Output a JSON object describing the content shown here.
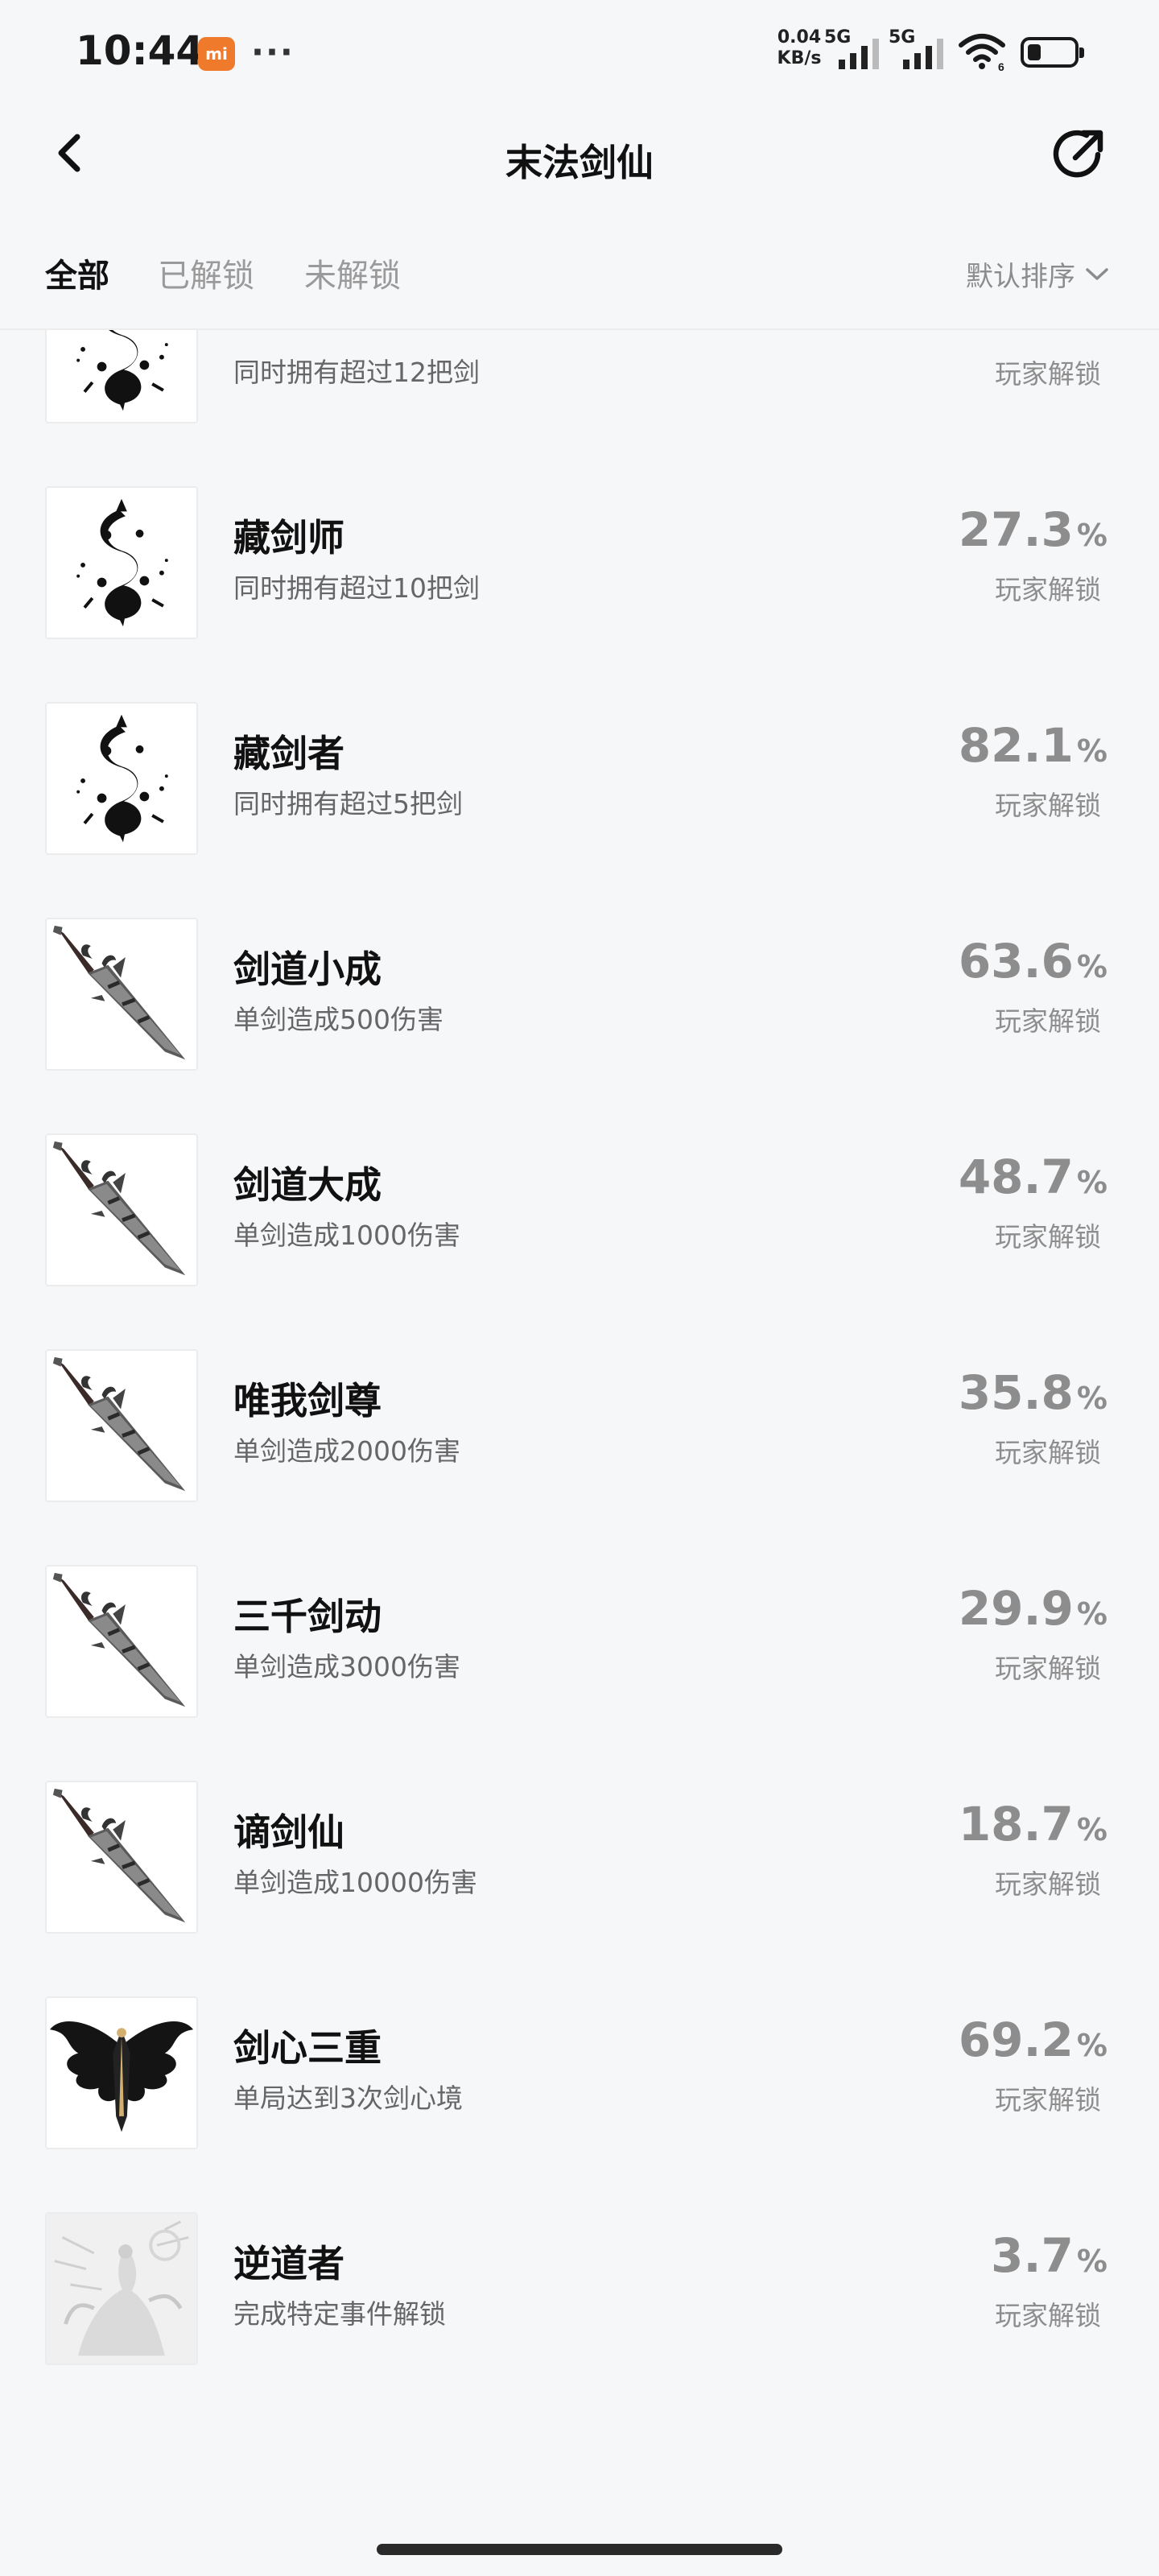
{
  "status_bar": {
    "time": "10:44",
    "mi_badge": "mi",
    "more": "···",
    "speed_value": "0.04",
    "speed_unit": "KB/s",
    "net1": "5G",
    "net2": "5G",
    "wifi_badge": "6",
    "battery_level_percent": 30
  },
  "header": {
    "title": "末法剑仙",
    "back_icon": "chevron-left-icon",
    "share_icon": "share-arrow-icon"
  },
  "tabs": [
    {
      "label": "全部",
      "active": true
    },
    {
      "label": "已解锁",
      "active": false
    },
    {
      "label": "未解锁",
      "active": false
    }
  ],
  "sort": {
    "label": "默认排序",
    "icon": "chevron-down-icon"
  },
  "unlock_label": "玩家解锁",
  "percent_sign": "%",
  "achievements": [
    {
      "title": "",
      "desc": "同时拥有超过12把剑",
      "percent": "",
      "icon": "rune-icon"
    },
    {
      "title": "藏剑师",
      "desc": "同时拥有超过10把剑",
      "percent": "27.3",
      "icon": "rune-icon"
    },
    {
      "title": "藏剑者",
      "desc": "同时拥有超过5把剑",
      "percent": "82.1",
      "icon": "rune-icon"
    },
    {
      "title": "剑道小成",
      "desc": "单剑造成500伤害",
      "percent": "63.6",
      "icon": "sword-icon"
    },
    {
      "title": "剑道大成",
      "desc": "单剑造成1000伤害",
      "percent": "48.7",
      "icon": "sword-icon"
    },
    {
      "title": "唯我剑尊",
      "desc": "单剑造成2000伤害",
      "percent": "35.8",
      "icon": "sword-icon"
    },
    {
      "title": "三千剑动",
      "desc": "单剑造成3000伤害",
      "percent": "29.9",
      "icon": "sword-icon"
    },
    {
      "title": "谪剑仙",
      "desc": "单剑造成10000伤害",
      "percent": "18.7",
      "icon": "sword-icon"
    },
    {
      "title": "剑心三重",
      "desc": "单局达到3次剑心境",
      "percent": "69.2",
      "icon": "wings-icon"
    },
    {
      "title": "逆道者",
      "desc": "完成特定事件解锁",
      "percent": "3.7",
      "icon": "immortal-figure-icon"
    }
  ]
}
